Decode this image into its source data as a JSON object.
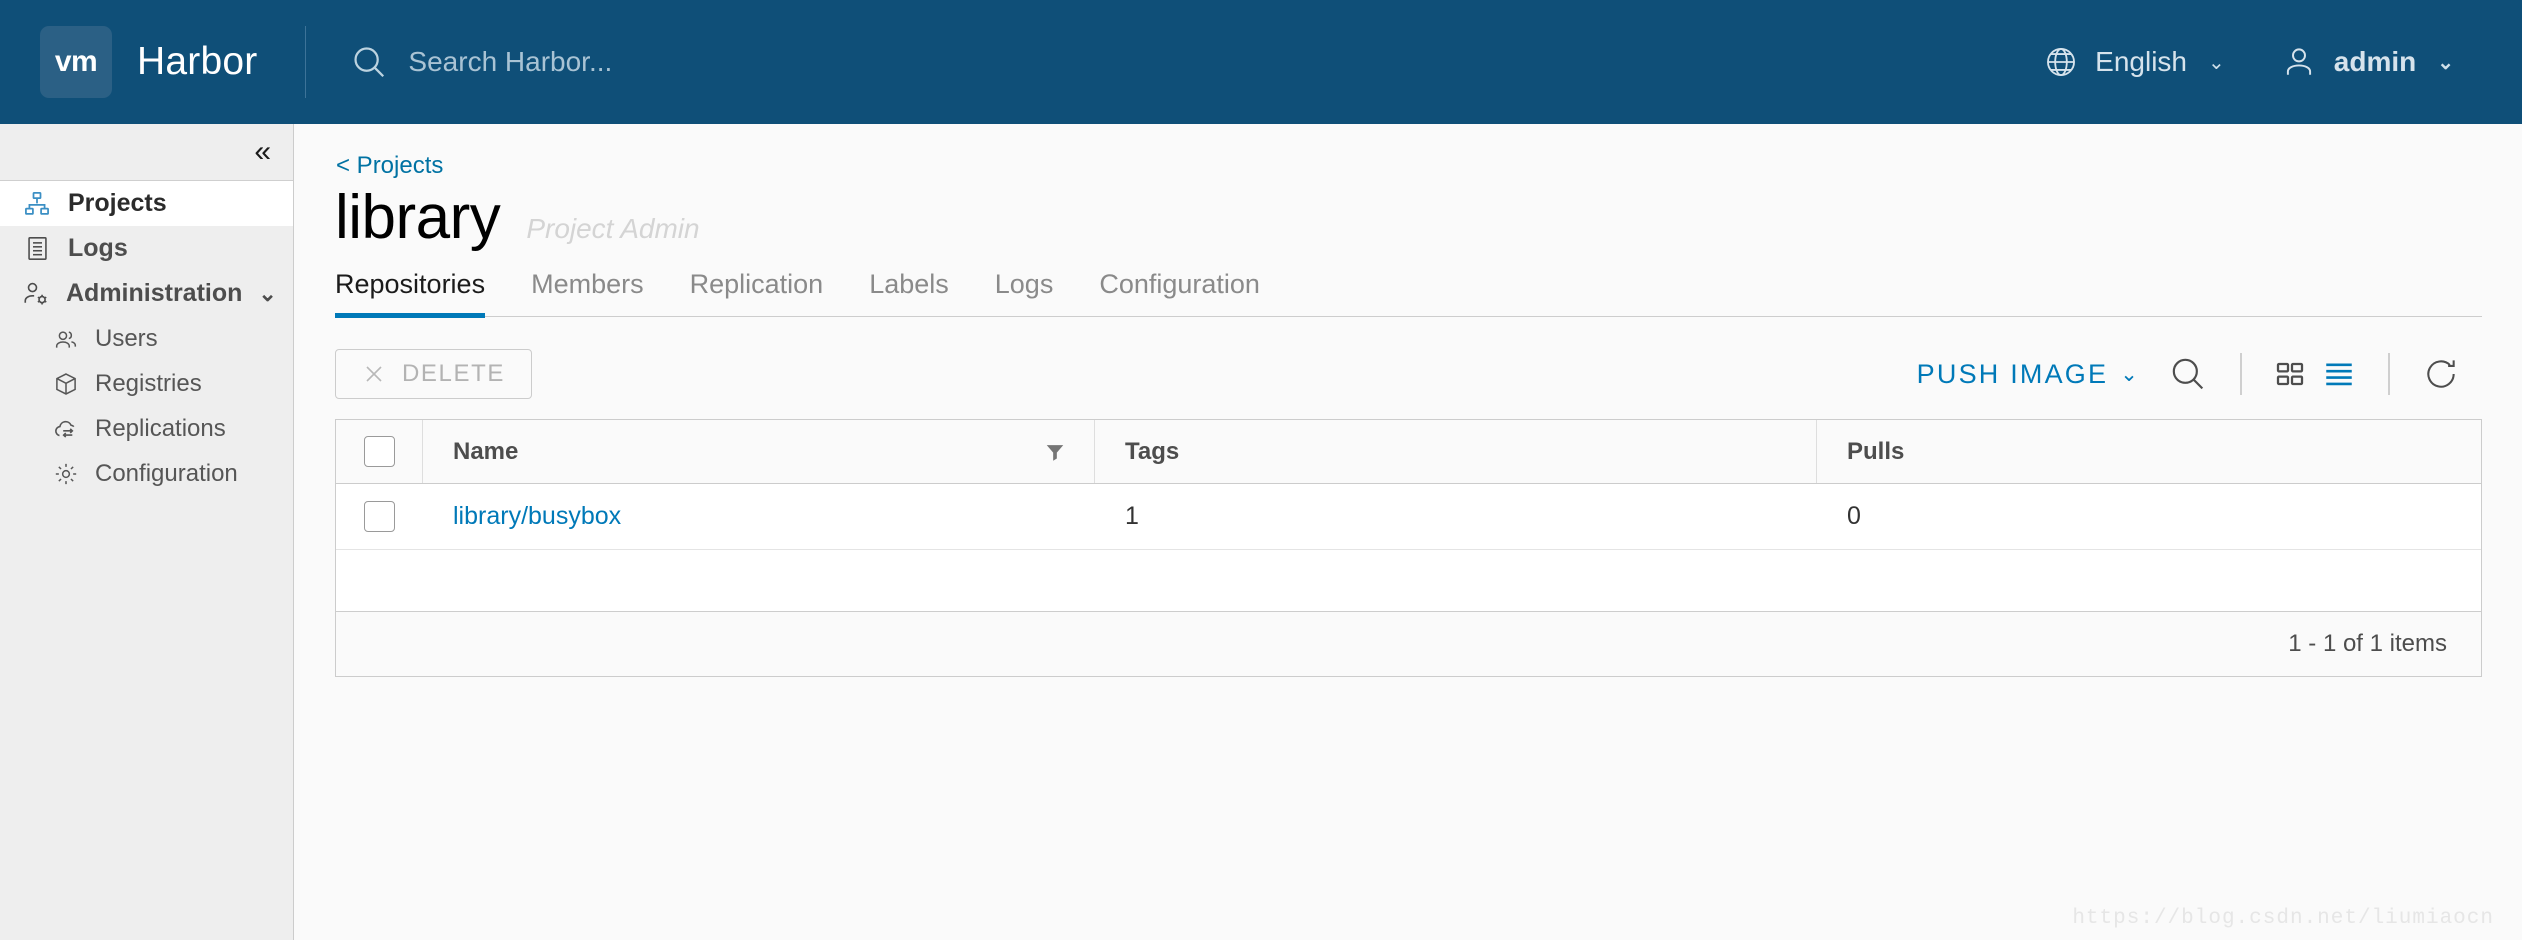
{
  "header": {
    "logo_text": "vm",
    "product_title": "Harbor",
    "search": {
      "placeholder": "Search Harbor...",
      "value": ""
    },
    "language": {
      "label": "English",
      "caret": "⌄"
    },
    "user": {
      "label": "admin",
      "caret": "⌄"
    }
  },
  "sidebar": {
    "collapse_glyph": "«",
    "items": [
      {
        "label": "Projects",
        "icon": "org-chart-icon",
        "active": true
      },
      {
        "label": "Logs",
        "icon": "list-document-icon",
        "active": false
      },
      {
        "label": "Administration",
        "icon": "user-gear-icon",
        "active": false,
        "expandable": true,
        "caret": "⌄"
      }
    ],
    "admin_children": [
      {
        "label": "Users",
        "icon": "users-icon"
      },
      {
        "label": "Registries",
        "icon": "cube-icon"
      },
      {
        "label": "Replications",
        "icon": "cloud-sync-icon"
      },
      {
        "label": "Configuration",
        "icon": "gear-icon"
      }
    ]
  },
  "main": {
    "breadcrumb": "< Projects",
    "project_name": "library",
    "project_role": "Project Admin",
    "tabs": [
      {
        "label": "Repositories",
        "active": true
      },
      {
        "label": "Members",
        "active": false
      },
      {
        "label": "Replication",
        "active": false
      },
      {
        "label": "Labels",
        "active": false
      },
      {
        "label": "Logs",
        "active": false
      },
      {
        "label": "Configuration",
        "active": false
      }
    ],
    "toolbar": {
      "delete_label": "DELETE",
      "delete_icon": "close-x-icon",
      "delete_disabled": true,
      "push_image_label": "PUSH IMAGE",
      "push_image_caret": "⌄",
      "search_icon": "search-icon",
      "grid_view_icon": "grid-view-icon",
      "list_view_icon": "list-view-icon",
      "list_view_active": true,
      "refresh_icon": "refresh-icon"
    },
    "table": {
      "columns": [
        "Name",
        "Tags",
        "Pulls"
      ],
      "name_filter_icon": "funnel-filter-icon",
      "rows": [
        {
          "name": "library/busybox",
          "tags": "1",
          "pulls": "0",
          "selected": false
        }
      ],
      "pagination": "1 - 1 of 1 items"
    }
  },
  "watermark": "https://blog.csdn.net/liumiaocn",
  "colors": {
    "header_bg": "#0f4f78",
    "accent_blue": "#0079b8",
    "link_blue": "#0072a3",
    "sidebar_bg": "#eeeeee",
    "page_bg": "#fafafa"
  }
}
